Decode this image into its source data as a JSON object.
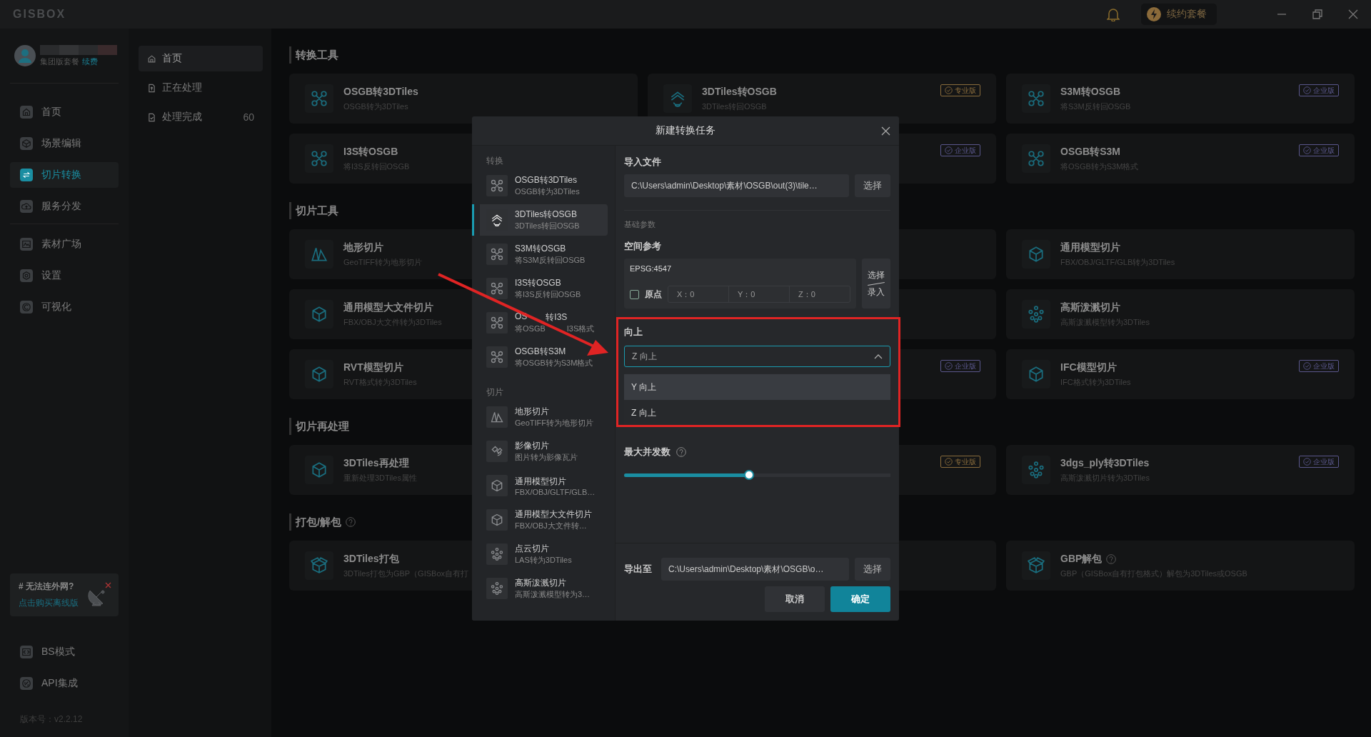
{
  "app": {
    "logo": "GISBOX",
    "renew": "续约套餐"
  },
  "profile": {
    "plan": "集团版套餐",
    "renew_link": "续费"
  },
  "nav_groups": [
    [
      {
        "label": "首页",
        "kind": "home",
        "selected": false
      },
      {
        "label": "场景编辑",
        "kind": "scene",
        "selected": false
      },
      {
        "label": "切片转换",
        "kind": "convert",
        "selected": true
      },
      {
        "label": "服务分发",
        "kind": "publish",
        "selected": false
      }
    ],
    [
      {
        "label": "素材广场",
        "kind": "assets",
        "selected": false
      },
      {
        "label": "设置",
        "kind": "settings",
        "selected": false
      },
      {
        "label": "可视化",
        "kind": "visual",
        "selected": false
      }
    ]
  ],
  "promo": {
    "title": "# 无法连外网?",
    "link": "点击购买离线版"
  },
  "nav_bottom": [
    {
      "label": "BS模式",
      "kind": "code",
      "selected": false
    },
    {
      "label": "API集成",
      "kind": "api",
      "selected": false
    }
  ],
  "version": "版本号：v2.2.12",
  "subnav": [
    {
      "label": "首页",
      "kind": "home",
      "selected": true
    },
    {
      "label": "正在处理",
      "kind": "upload",
      "selected": false
    },
    {
      "label": "处理完成",
      "kind": "done",
      "selected": false,
      "count": "60"
    }
  ],
  "sections": [
    {
      "title": "转换工具",
      "cards": [
        {
          "kind": "conversion",
          "title": "OSGB转3DTiles",
          "desc": "OSGB转为3DTiles"
        },
        {
          "kind": "layers",
          "title": "3DTiles转OSGB",
          "desc": "3DTiles转回OSGB",
          "badge": {
            "label": "专业版",
            "color": "#8a6c3c"
          }
        },
        {
          "kind": "conversion",
          "title": "S3M转OSGB",
          "desc": "将S3M反转回OSGB",
          "badge": {
            "label": "企业版",
            "color": "#5a578c"
          }
        },
        {
          "kind": "conversion",
          "title": "I3S转OSGB",
          "desc": "将I3S反转回OSGB"
        },
        {
          "kind": "covered",
          "badge": {
            "label": "企业版",
            "color": "#5a578c"
          }
        },
        {
          "kind": "conversion",
          "title": "OSGB转S3M",
          "desc": "将OSGB转为S3M格式",
          "badge": {
            "label": "企业版",
            "color": "#5a578c"
          }
        }
      ]
    },
    {
      "title": "切片工具",
      "cards": [
        {
          "kind": "terrain",
          "title": "地形切片",
          "desc": "GeoTIFF转为地形切片"
        },
        {
          "kind": "covered"
        },
        {
          "kind": "model",
          "title": "通用模型切片",
          "desc": "FBX/OBJ/GLTF/GLB转为3DTiles"
        },
        {
          "kind": "model",
          "title": "通用模型大文件切片",
          "desc": "FBX/OBJ大文件转为3DTiles"
        },
        {
          "kind": "covered"
        },
        {
          "kind": "points",
          "title": "高斯泼溅切片",
          "desc": "高斯泼溅模型转为3DTiles"
        },
        {
          "kind": "model",
          "title": "RVT模型切片",
          "desc": "RVT格式转为3DTiles"
        },
        {
          "kind": "covered",
          "badge": {
            "label": "企业版",
            "color": "#5a578c"
          }
        },
        {
          "kind": "model",
          "title": "IFC模型切片",
          "desc": "IFC格式转为3DTiles",
          "badge": {
            "label": "企业版",
            "color": "#5a578c"
          }
        }
      ]
    },
    {
      "title": "切片再处理",
      "cards": [
        {
          "kind": "model",
          "title": "3DTiles再处理",
          "desc": "重新处理3DTiles属性"
        },
        {
          "kind": "covered",
          "badge": {
            "label": "专业版",
            "color": "#8a6c3c"
          }
        },
        {
          "kind": "points",
          "title": "3dgs_ply转3DTiles",
          "desc": "高斯泼溅切片转为3DTiles",
          "badge": {
            "label": "企业版",
            "color": "#5a578c"
          }
        }
      ]
    },
    {
      "title": "打包/解包",
      "help": true,
      "cards": [
        {
          "kind": "package",
          "title": "3DTiles打包",
          "desc": "3DTiles打包为GBP（GISBox自有打"
        },
        {
          "kind": "covered"
        },
        {
          "kind": "package",
          "title": "GBP解包",
          "desc": "GBP（GISBox自有打包格式）解包为3DTiles或OSGB",
          "help": true
        }
      ]
    }
  ],
  "dialog": {
    "title": "新建转换任务",
    "groups": [
      {
        "label": "转换",
        "items": [
          {
            "kind": "conversion",
            "title": "OSGB转3DTiles",
            "desc": "OSGB转为3DTiles",
            "selected": false
          },
          {
            "kind": "layers",
            "title": "3DTiles转OSGB",
            "desc": "3DTiles转回OSGB",
            "selected": true
          },
          {
            "kind": "conversion",
            "title": "S3M转OSGB",
            "desc": "将S3M反转回OSGB",
            "selected": false
          },
          {
            "kind": "conversion",
            "title": "I3S转OSGB",
            "desc": "将I3S反转回OSGB",
            "selected": false
          },
          {
            "kind": "conversion",
            "title_parts": [
              "OS",
              "转I3S"
            ],
            "desc_parts": [
              "将OSGB",
              "I3S格式"
            ],
            "selected": false
          },
          {
            "kind": "conversion",
            "title": "OSGB转S3M",
            "desc": "将OSGB转为S3M格式",
            "selected": false
          }
        ]
      },
      {
        "label": "切片",
        "items": [
          {
            "kind": "terrain",
            "title": "地形切片",
            "desc": "GeoTIFF转为地形切片",
            "selected": false
          },
          {
            "kind": "imagery",
            "title": "影像切片",
            "desc": "图片转为影像瓦片",
            "selected": false
          },
          {
            "kind": "model",
            "title": "通用模型切片",
            "desc": "FBX/OBJ/GLTF/GLB…",
            "selected": false
          },
          {
            "kind": "model",
            "title": "通用模型大文件切片",
            "desc": "FBX/OBJ大文件转…",
            "selected": false
          },
          {
            "kind": "points",
            "title": "点云切片",
            "desc": "LAS转为3DTiles",
            "selected": false
          },
          {
            "kind": "points",
            "title": "高斯泼溅切片",
            "desc": "高斯泼溅模型转为3…",
            "selected": false
          }
        ]
      }
    ],
    "import_label": "导入文件",
    "import_path": "C:\\Users\\admin\\Desktop\\素材\\OSGB\\out(3)\\tile…",
    "choose": "选择",
    "params_label": "基础参数",
    "coord": {
      "label": "空间参考",
      "crs": "EPSG:4547",
      "origin_label": "原点",
      "origin_checked": false,
      "fields": [
        "X：0",
        "Y：0",
        "Z：0"
      ],
      "button_top": "选择",
      "button_bottom": "录入"
    },
    "up": {
      "label": "向上",
      "value": "Z 向上",
      "open": true,
      "options": [
        {
          "label": "Y 向上",
          "highlighted": true
        },
        {
          "label": "Z 向上",
          "highlighted": false
        }
      ]
    },
    "concurrency": {
      "label": "最大并发数",
      "level": 0.47
    },
    "export": {
      "label": "导出至",
      "path": "C:\\Users\\admin\\Desktop\\素材\\OSGB\\o…",
      "button": "选择"
    },
    "cancel": "取消",
    "ok": "确定"
  }
}
